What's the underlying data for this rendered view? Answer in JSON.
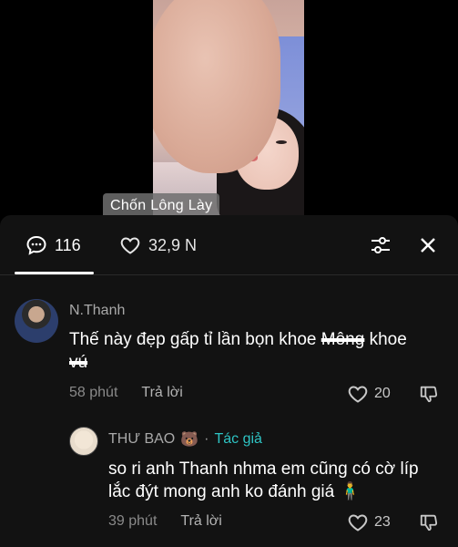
{
  "video": {
    "caption_tag": "Chốn Lông Lày"
  },
  "tabs": {
    "comments_count": "116",
    "likes_count": "32,9 N"
  },
  "comments": [
    {
      "username": "N.Thanh",
      "text_before": "Thế này đẹp gấp tỉ lần bọn khoe ",
      "text_struck_1": "Mông",
      "text_middle": " khoe ",
      "text_struck_2": "vú",
      "time": "58 phút",
      "reply_label": "Trả lời",
      "likes": "20"
    },
    {
      "username": "THƯ BAO",
      "username_emoji": "🐻",
      "dot": "·",
      "author_tag": "Tác giả",
      "text": "so ri anh Thanh nhma em cũng có cờ líp lắc đýt mong anh ko đánh giá 🧍‍♂️",
      "time": "39 phút",
      "reply_label": "Trả lời",
      "likes": "23"
    }
  ],
  "icons": {
    "comments_tab": "comment-bubble-icon",
    "likes_tab": "heart-icon",
    "filter": "sliders-icon",
    "close": "close-icon",
    "like": "heart-icon",
    "dislike": "thumbs-down-icon"
  },
  "colors": {
    "panel_bg": "#121212",
    "author_tag": "#2ec4c4",
    "muted_text": "#8a8a8a"
  }
}
